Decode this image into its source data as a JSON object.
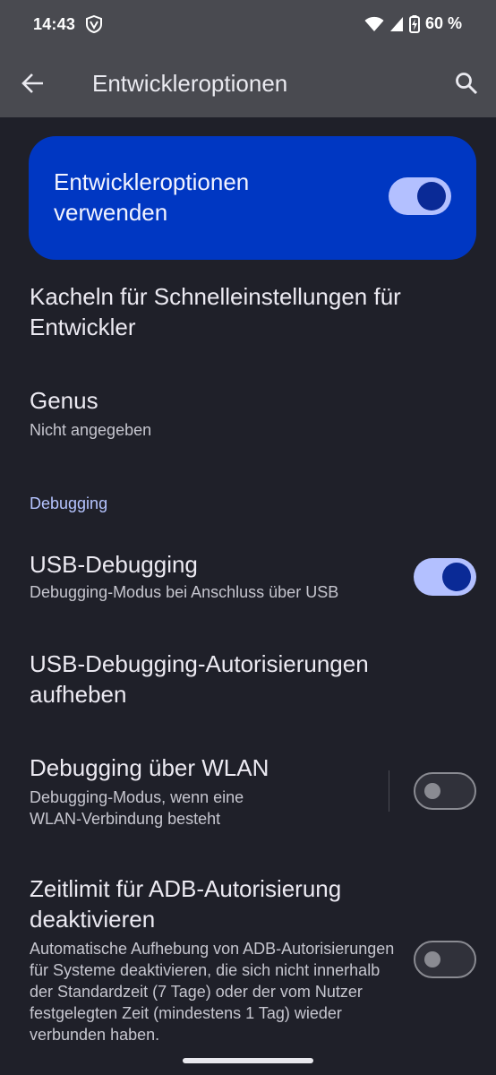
{
  "status_bar": {
    "time": "14:43",
    "battery": "60 %",
    "icons": [
      "vpn-shield-icon",
      "wifi-icon",
      "cellular-signal-icon",
      "battery-charging-icon"
    ]
  },
  "app_bar": {
    "title": "Entwickleroptionen",
    "back_icon": "arrow-back-icon",
    "search_icon": "search-icon"
  },
  "master_toggle": {
    "label": "Entwickleroptionen verwenden",
    "on": true
  },
  "items": {
    "quick_tiles": {
      "title": "Kacheln für Schnelleinstellungen für Entwickler"
    },
    "genus": {
      "title": "Genus",
      "subtitle": "Nicht angegeben"
    },
    "section_debugging": "Debugging",
    "usb_debugging": {
      "title": "USB-Debugging",
      "subtitle": "Debugging-Modus bei Anschluss über USB",
      "on": true
    },
    "revoke_auth": {
      "title": "USB-Debugging-Autorisierungen aufheben"
    },
    "wifi_debugging": {
      "title": "Debugging über WLAN",
      "subtitle": "Debugging-Modus, wenn eine WLAN-Verbindung besteht",
      "on": false
    },
    "adb_timeout": {
      "title": "Zeitlimit für ADB-Autorisierung deaktivieren",
      "subtitle": "Automatische Aufhebung von ADB-Autorisierungen für Systeme deaktivieren, die sich nicht innerhalb der Standardzeit (7 Tage) oder der vom Nutzer festgelegten Zeit (mindestens 1 Tag) wieder verbunden haben.",
      "on": false
    }
  },
  "colors": {
    "background": "#1f2029",
    "app_bar": "#494a50",
    "accent_card": "#0037c2",
    "switch_track_on": "#b3c0ff",
    "switch_knob_on": "#0a2a96",
    "section_header": "#b5c4ff"
  }
}
